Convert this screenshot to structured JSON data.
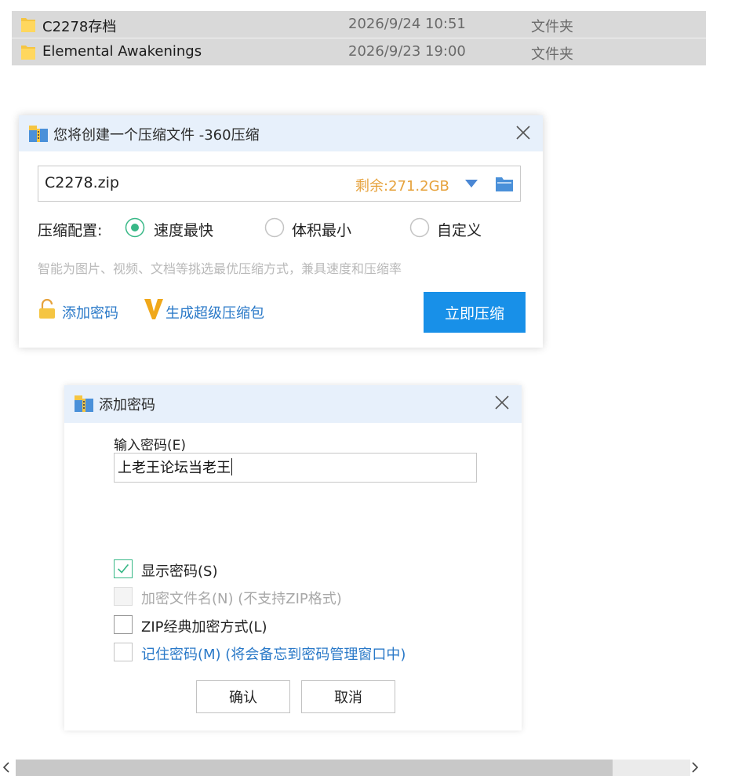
{
  "files": [
    {
      "name": "C2278存档",
      "date": "2026/9/24 10:51",
      "type": "文件夹"
    },
    {
      "name": "Elemental Awakenings",
      "date": "2026/9/23 19:00",
      "type": "文件夹"
    }
  ],
  "compress_dialog": {
    "title": "您将创建一个压缩文件 -360压缩",
    "filename": "C2278.zip",
    "space_left": "剩余:271.2GB",
    "config_label": "压缩配置:",
    "options": [
      "速度最快",
      "体积最小",
      "自定义"
    ],
    "selected_option": "速度最快",
    "hint": "智能为图片、视频、文档等挑选最优压缩方式，兼具速度和压缩率",
    "add_password": "添加密码",
    "super_pack": "生成超级压缩包",
    "compress_now": "立即压缩"
  },
  "password_dialog": {
    "title": "添加密码",
    "input_label": "输入密码(E)",
    "password_value": "上老王论坛当老王",
    "checkboxes": [
      {
        "label": "显示密码(S)",
        "checked": true,
        "disabled": false
      },
      {
        "label": "加密文件名(N) (不支持ZIP格式)",
        "checked": false,
        "disabled": true
      },
      {
        "label": "ZIP经典加密方式(L)",
        "checked": false,
        "disabled": false
      },
      {
        "label": "记住密码(M) (将会备忘到密码管理窗口中)",
        "checked": false,
        "disabled": false
      }
    ],
    "confirm": "确认",
    "cancel": "取消"
  },
  "colors": {
    "accent": "#1890e8",
    "link": "#2a79c8",
    "warning": "#e6a23c",
    "radio_selected": "#38b887",
    "titlebar": "#e7f0fb"
  }
}
